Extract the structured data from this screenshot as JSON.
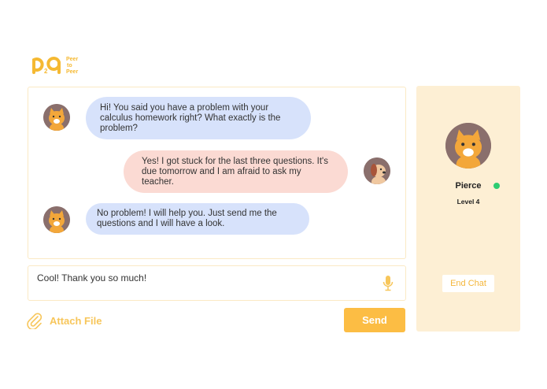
{
  "brand": {
    "logo_tag_line1": "Peer",
    "logo_tag_line2": "to",
    "logo_tag_line3": "Peer",
    "accent": "#fcbd44"
  },
  "chat": {
    "messages": [
      {
        "from": "tutor",
        "avatar": "cat-avatar-icon",
        "text": "Hi! You said you have a problem with your calculus homework right? What exactly is the problem?"
      },
      {
        "from": "student",
        "avatar": "dog-avatar-icon",
        "text": "Yes! I got stuck for the last three questions. It's due tomorrow and I am afraid to ask my teacher."
      },
      {
        "from": "tutor",
        "avatar": "cat-avatar-icon",
        "text": "No problem! I will help you. Just send me the questions and I will have a look."
      }
    ]
  },
  "composer": {
    "value": "Cool! Thank you so much!",
    "mic_icon": "microphone-icon",
    "attach_label": "Attach File",
    "attach_icon": "paperclip-icon",
    "send_label": "Send"
  },
  "partner": {
    "name": "Pierce",
    "level": "Level 4",
    "status_color": "#2ecc71",
    "end_chat_label": "End Chat"
  }
}
